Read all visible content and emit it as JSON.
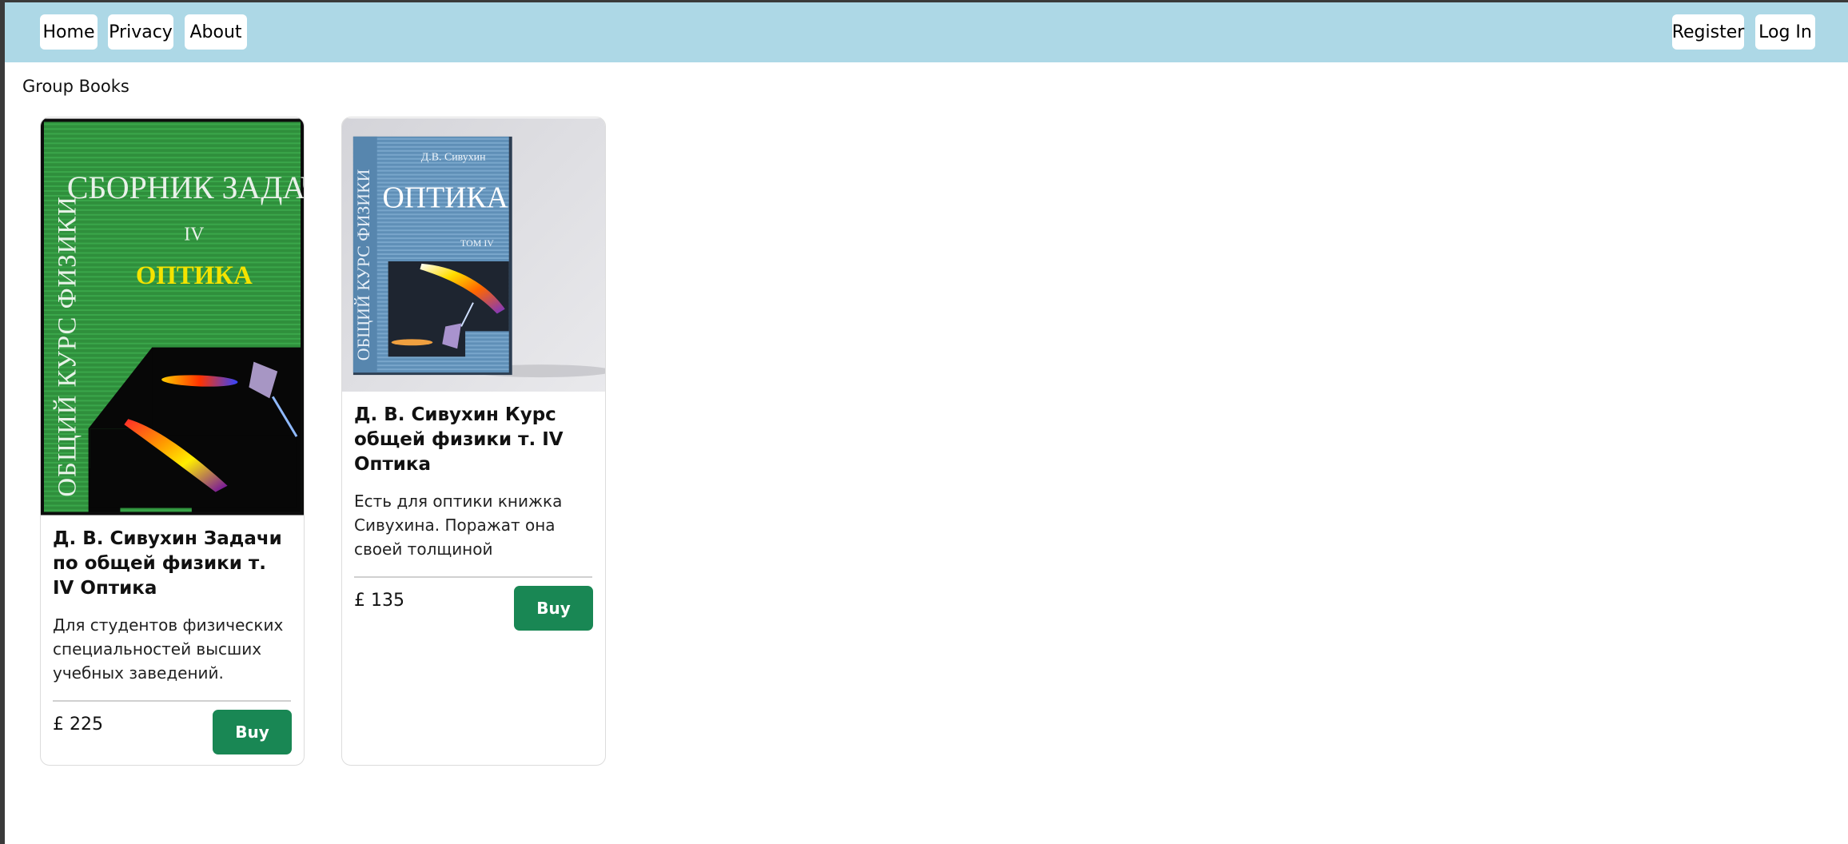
{
  "nav": {
    "home": "Home",
    "privacy": "Privacy",
    "about": "About",
    "register": "Register",
    "login": "Log In"
  },
  "page": {
    "heading": "Group Books"
  },
  "books": [
    {
      "cover": {
        "series": "ОБЩИЙ КУРС ФИЗИКИ",
        "title": "СБОРНИК ЗАДАЧ",
        "volume": "IV",
        "subtitle": "ОПТИКА",
        "bg": "#2f8f3c"
      },
      "title": "Д. В. Сивухин Задачи по общей физики т. IV Оптика",
      "description": "Для студентов физических специальностей высших учебных заведений.",
      "price": "£ 225",
      "buy_label": "Buy"
    },
    {
      "cover": {
        "author": "Д.В. Сивухин",
        "series": "ОБЩИЙ КУРС ФИЗИКИ",
        "title": "ОПТИКА",
        "volume": "ТОМ IV",
        "bg": "#5f8fb7"
      },
      "title": "Д. В. Сивухин Курс общей физики т. IV Оптика",
      "description": "Есть для оптики книжка Сивухина. Поражат она своей толщиной",
      "price": "£ 135",
      "buy_label": "Buy"
    }
  ],
  "colors": {
    "navbar": "#add8e6",
    "buy_button": "#198754"
  }
}
